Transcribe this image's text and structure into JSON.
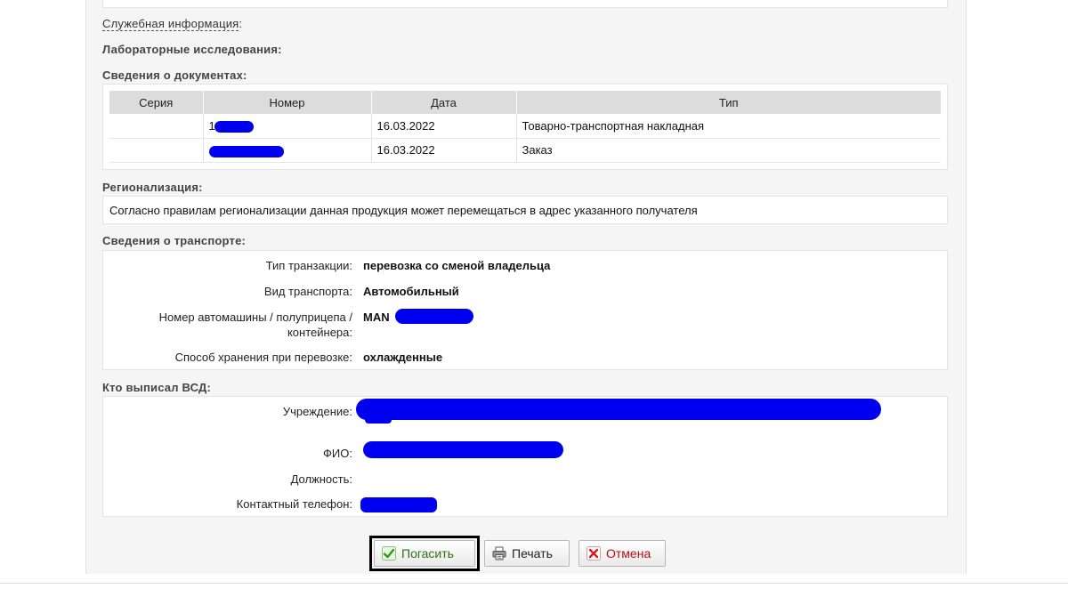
{
  "sections": {
    "service_info": "Служебная информация",
    "service_info_suffix": ":",
    "lab_research": "Лабораторные исследования:",
    "documents": "Сведения о документах:",
    "regionalization": "Регионализация:",
    "transport": "Сведения о транспорте:",
    "issuer": "Кто выписал ВСД:"
  },
  "documents_table": {
    "headers": [
      "Серия",
      "Номер",
      "Дата",
      "Тип"
    ],
    "rows": [
      {
        "series": "",
        "number": "1",
        "date": "16.03.2022",
        "type": "Товарно-транспортная накладная"
      },
      {
        "series": "",
        "number": "",
        "date": "16.03.2022",
        "type": "Заказ"
      }
    ]
  },
  "regionalization_text": "Согласно правилам регионализации данная продукция может перемещаться в адрес указанного получателя",
  "transport": {
    "transaction_type_label": "Тип транзакции:",
    "transaction_type_value": "перевозка со сменой владельца",
    "vehicle_type_label": "Вид транспорта:",
    "vehicle_type_value": "Автомобильный",
    "vehicle_number_label_1": "Номер автомашины / полуприцепа /",
    "vehicle_number_label_2": "контейнера:",
    "vehicle_number_value": "MAN",
    "storage_label": "Способ хранения при перевозке:",
    "storage_value": "охлажденные"
  },
  "issuer": {
    "institution_label": "Учреждение:",
    "name_label": "ФИО:",
    "position_label": "Должность:",
    "phone_label": "Контактный телефон:"
  },
  "buttons": {
    "repay": "Погасить",
    "print": "Печать",
    "cancel": "Отмена"
  },
  "colors": {
    "redaction": "#0000f0",
    "repay_text": "#2f6f12",
    "cancel_text": "#b01010"
  }
}
